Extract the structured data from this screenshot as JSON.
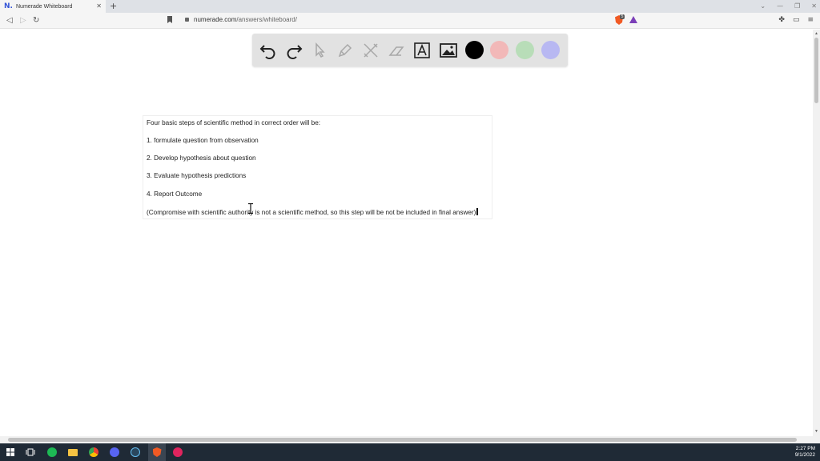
{
  "browser": {
    "tab_title": "Numerade Whiteboard",
    "tab_favicon": "N.",
    "url_domain": "numerade.com",
    "url_path": "/answers/whiteboard/",
    "brave_badge": "5"
  },
  "toolbar_tools": [
    {
      "name": "undo-icon",
      "glyph": "↶"
    },
    {
      "name": "redo-icon",
      "glyph": "↷"
    },
    {
      "name": "pointer-icon",
      "glyph": "⬉"
    },
    {
      "name": "pen-icon",
      "glyph": "✎"
    },
    {
      "name": "tools-icon",
      "glyph": "✕"
    },
    {
      "name": "eraser-icon",
      "glyph": "▱"
    },
    {
      "name": "text-tool-icon",
      "glyph": "A"
    },
    {
      "name": "image-icon",
      "glyph": "▣"
    }
  ],
  "colors": {
    "black": "#000000",
    "red": "#f2b8b8",
    "green": "#b8ddb8",
    "blue": "#b8b8f2"
  },
  "text_box": {
    "intro": "Four basic steps of scientific method in correct order will be:",
    "step1": "1. formulate question from observation",
    "step2": "2. Develop hypothesis about question",
    "step3": "3. Evaluate hypothesis predictions",
    "step4": "4. Report Outcome",
    "note": "(Compromise with scientific authority is not a scientific method, so this step will be not be included in final answer)"
  },
  "clock": {
    "time": "2:27 PM",
    "date": "9/1/2022"
  }
}
